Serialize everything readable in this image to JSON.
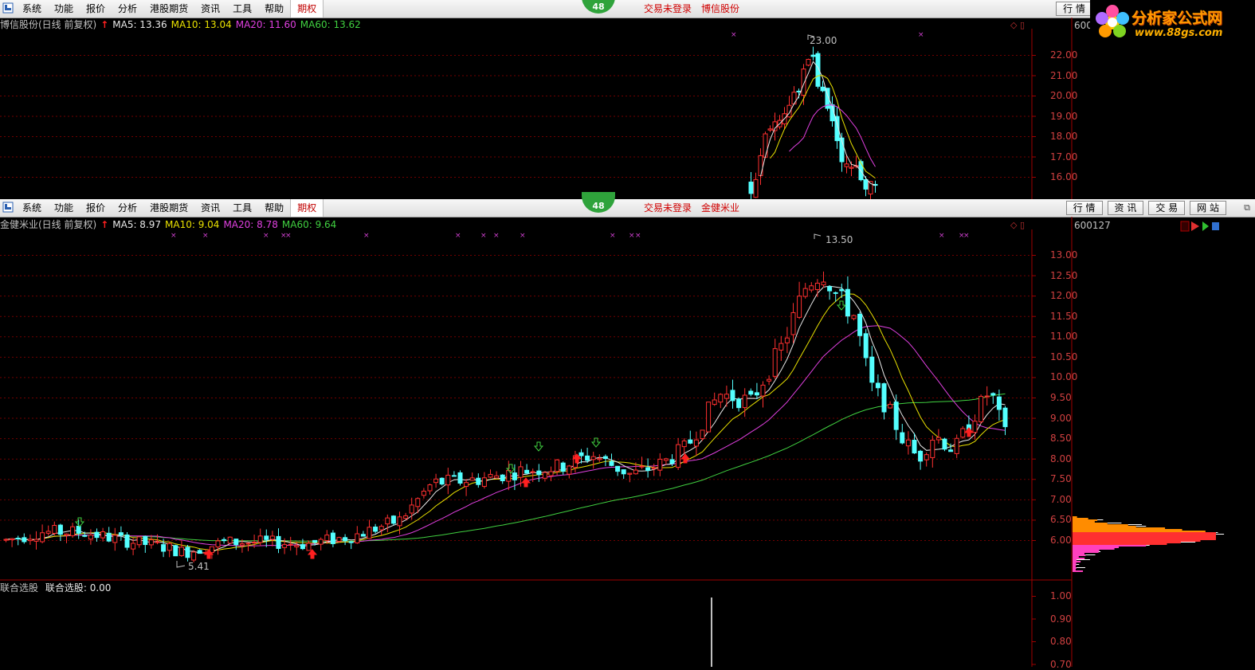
{
  "menu": {
    "items": [
      "系统",
      "功能",
      "报价",
      "分析",
      "港股期货",
      "资讯",
      "工具",
      "帮助"
    ],
    "highlight": "期权",
    "badge": "48",
    "trade_status": "交易未登录"
  },
  "window_top": {
    "stock_title": "博信股份",
    "buttons": [
      "行 情"
    ],
    "info": {
      "name": "博信股份(日线 前复权)",
      "ma5": "MA5: 13.36",
      "ma10": "MA10: 13.04",
      "ma20": "MA20: 11.60",
      "ma60": "MA60: 13.62"
    },
    "code": "600",
    "peak_label": "23.00",
    "y_ticks": [
      "22.00",
      "21.00",
      "20.00",
      "19.00",
      "18.00",
      "17.00",
      "16.00"
    ]
  },
  "window_bottom": {
    "stock_title": "金健米业",
    "buttons": [
      "行 情",
      "资 讯",
      "交 易",
      "网 站"
    ],
    "info": {
      "name": "金健米业(日线 前复权)",
      "ma5": "MA5: 8.97",
      "ma10": "MA10: 9.04",
      "ma20": "MA20: 8.78",
      "ma60": "MA60: 9.64"
    },
    "code": "600127",
    "peak_label": "13.50",
    "low_label": "5.41",
    "y_ticks": [
      "13.00",
      "12.50",
      "12.00",
      "11.50",
      "11.00",
      "10.50",
      "10.00",
      "9.50",
      "9.00",
      "8.50",
      "8.00",
      "7.50",
      "7.00",
      "6.50",
      "6.00"
    ]
  },
  "indicator": {
    "title": "联合选股",
    "value_label": "联合选股: 0.00",
    "y_ticks": [
      "1.00",
      "0.90",
      "0.80",
      "0.70"
    ]
  },
  "watermark": {
    "title": "分析家公式网",
    "url": "www.88gs.com"
  },
  "colors": {
    "up": "#ff3030",
    "down": "#54ffff",
    "ma5": "#e8e8e8",
    "ma10": "#e8e000",
    "ma20": "#e040e0",
    "ma60": "#40d040",
    "grid": "#800000"
  }
}
